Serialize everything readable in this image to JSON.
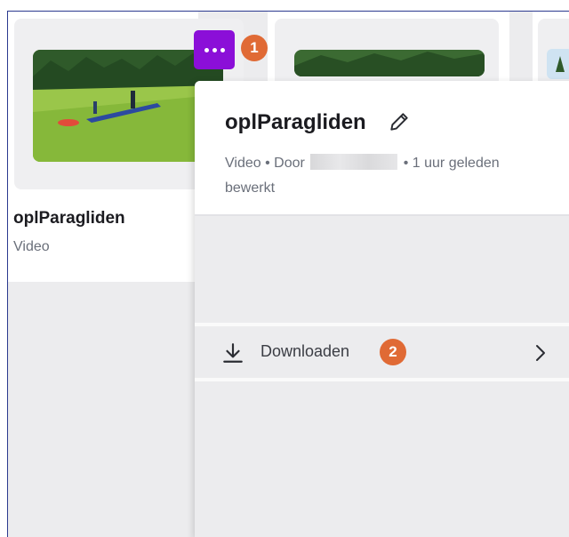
{
  "cards": [
    {
      "title": "oplParagliden",
      "subtitle": "Video"
    }
  ],
  "more_button": {
    "icon": "more-dots-icon"
  },
  "badges": {
    "first": "1",
    "second": "2"
  },
  "panel": {
    "title": "oplParagliden",
    "meta_type": "Video",
    "meta_by": "• Door",
    "meta_time": "• 1 uur geleden bewerkt",
    "download_label": "Downloaden"
  },
  "colors": {
    "accent_purple": "#8b0fd8",
    "badge_orange": "#e06a35"
  }
}
